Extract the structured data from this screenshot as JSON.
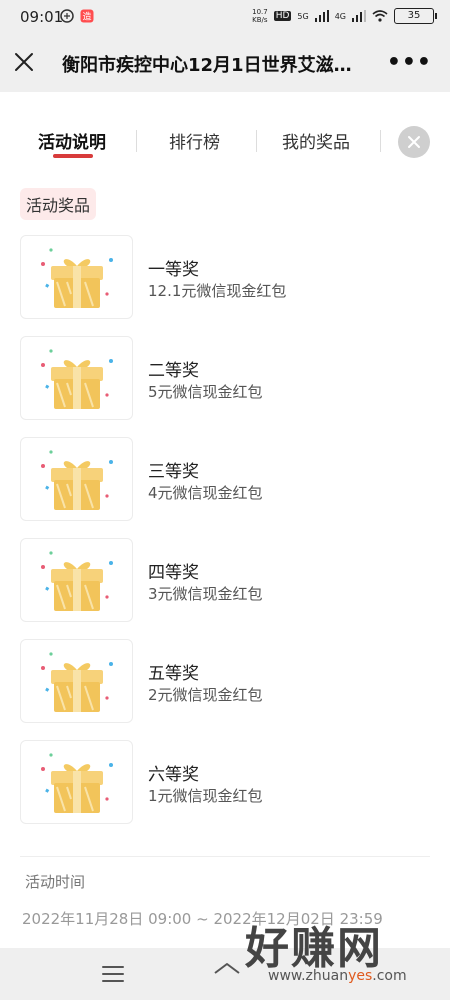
{
  "status_bar": {
    "time": "09:01",
    "net_speed": "10.7\nKB/s",
    "sim1": "HD",
    "network1": "5G",
    "network2": "4G",
    "battery": "35"
  },
  "nav": {
    "title": "衡阳市疾控中心12月1日世界艾滋…",
    "more": "•••"
  },
  "tabs": [
    {
      "label": "活动说明",
      "active": true
    },
    {
      "label": "排行榜",
      "active": false
    },
    {
      "label": "我的奖品",
      "active": false
    }
  ],
  "section": {
    "prizes_title": "活动奖品"
  },
  "prizes": [
    {
      "name": "一等奖",
      "desc": "12.1元微信现金红包"
    },
    {
      "name": "二等奖",
      "desc": "5元微信现金红包"
    },
    {
      "name": "三等奖",
      "desc": "4元微信现金红包"
    },
    {
      "name": "四等奖",
      "desc": "3元微信现金红包"
    },
    {
      "name": "五等奖",
      "desc": "2元微信现金红包"
    },
    {
      "name": "六等奖",
      "desc": "1元微信现金红包"
    }
  ],
  "activity_time": {
    "label": "活动时间",
    "range": "2022年11月28日 09:00 ~ 2022年12月02日 23:59"
  },
  "watermark": {
    "text": "好赚网",
    "url_prefix": "www.zhuan",
    "url_highlight": "yes",
    "url_suffix": ".com"
  },
  "colors": {
    "accent": "#d83b3b",
    "chip_bg": "#fdeaea",
    "gift": "#f2c45a"
  }
}
